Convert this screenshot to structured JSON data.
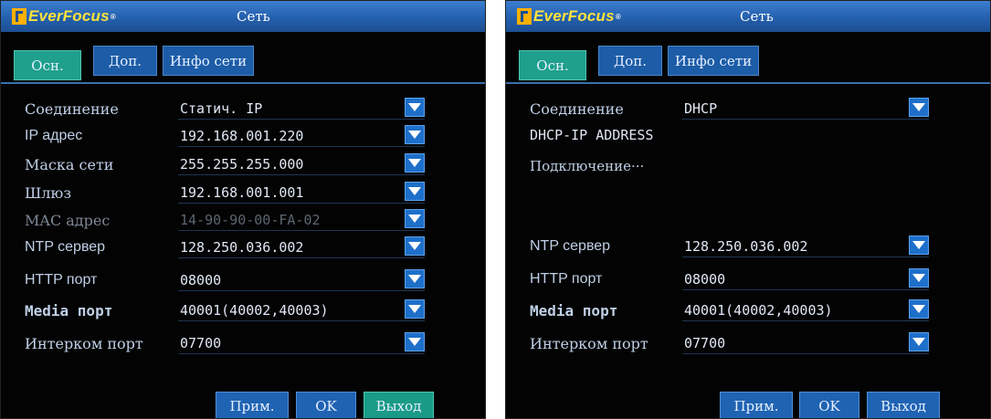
{
  "panels": [
    {
      "logo_text": "EverFocus",
      "title": "Сеть",
      "tabs": [
        "Осн.",
        "Доп.",
        "Инфо сети"
      ],
      "rows": [
        {
          "label": "Соединение",
          "value": "Статич. IP"
        },
        {
          "label": "IP адрес",
          "value": "192.168.001.220"
        },
        {
          "label": "Маска сети",
          "value": "255.255.255.000"
        },
        {
          "label": "Шлюз",
          "value": "192.168.001.001"
        },
        {
          "label": "MAC адрес",
          "value": "14-90-90-00-FA-02"
        },
        {
          "label": "NTP сервер",
          "value": "128.250.036.002"
        },
        {
          "label": "HTTP порт",
          "value": "08000"
        },
        {
          "label": "Media порт",
          "value": "40001(40002,40003)"
        },
        {
          "label": "Интерком порт",
          "value": "07700"
        }
      ],
      "buttons": {
        "apply": "Прим.",
        "ok": "OK",
        "exit": "Выход"
      }
    },
    {
      "logo_text": "EverFocus",
      "title": "Сеть",
      "tabs": [
        "Осн.",
        "Доп.",
        "Инфо сети"
      ],
      "connection": {
        "label": "Соединение",
        "value": "DHCP"
      },
      "dhcp_ip_label": "DHCP-IP ADDRESS",
      "connecting_text": "Подключение···",
      "rows": [
        {
          "label": "NTP сервер",
          "value": "128.250.036.002"
        },
        {
          "label": "HTTP порт",
          "value": "08000"
        },
        {
          "label": "Media порт",
          "value": "40001(40002,40003)"
        },
        {
          "label": "Интерком порт",
          "value": "07700"
        }
      ],
      "buttons": {
        "apply": "Прим.",
        "ok": "OK",
        "exit": "Выход"
      }
    }
  ],
  "colors": {
    "titlebar": "#2460ad",
    "active_tab": "#1ea08c",
    "inactive_tab": "#1d5ca6",
    "dropdown": "#1e6fc9",
    "background": "#030303"
  },
  "icons": {
    "dropdown": "chevron-down-icon",
    "logo": "everfocus-logo-icon"
  }
}
